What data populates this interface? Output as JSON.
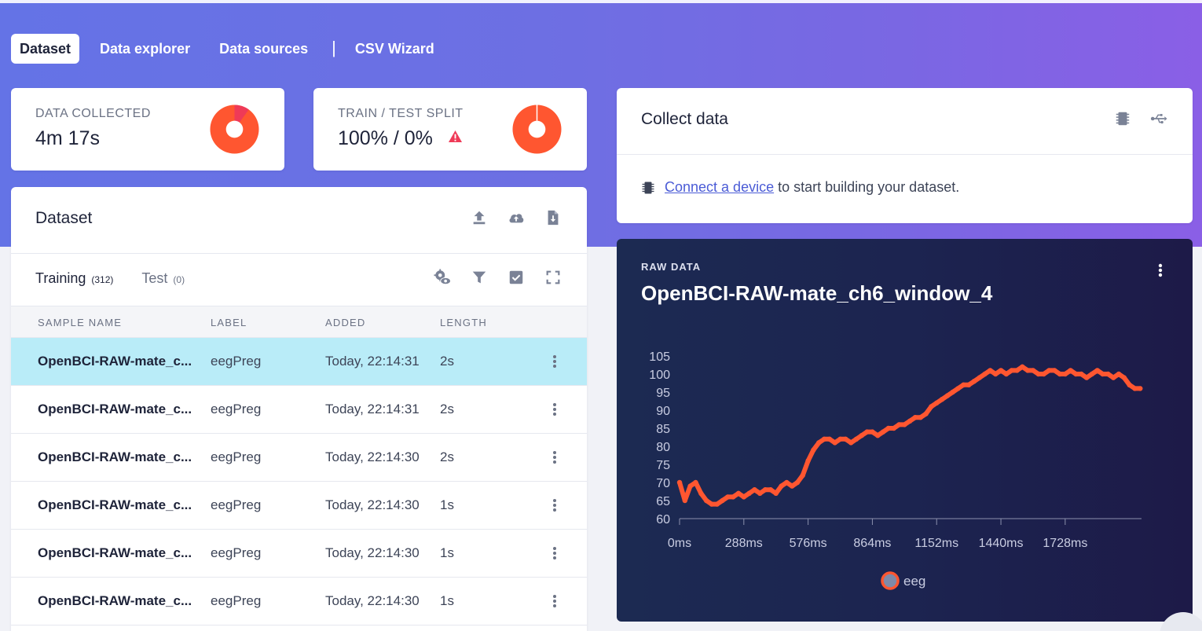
{
  "tabs": [
    {
      "label": "Dataset",
      "active": true
    },
    {
      "label": "Data explorer",
      "active": false
    },
    {
      "label": "Data sources",
      "active": false
    },
    {
      "label": "CSV Wizard",
      "active": false
    }
  ],
  "tab_separator": "|",
  "stats": {
    "collected": {
      "label": "DATA COLLECTED",
      "value": "4m 17s",
      "fraction_highlight": 0.1
    },
    "split": {
      "label": "TRAIN / TEST SPLIT",
      "value": "100% / 0%",
      "warning_icon": "warning-triangle-icon",
      "fraction_train": 1.0
    }
  },
  "dataset": {
    "title": "Dataset",
    "actions": [
      "upload-icon",
      "cloud-upload-icon",
      "download-file-icon"
    ],
    "subtabs": [
      {
        "label": "Training",
        "count": "(312)",
        "active": true
      },
      {
        "label": "Test",
        "count": "(0)",
        "active": false
      }
    ],
    "list_actions": [
      "settings-eye-icon",
      "filter-icon",
      "check-square-icon",
      "expand-icon"
    ],
    "columns": [
      "SAMPLE NAME",
      "LABEL",
      "ADDED",
      "LENGTH"
    ],
    "rows": [
      {
        "name": "OpenBCI-RAW-mate_c...",
        "label": "eegPreg",
        "added": "Today, 22:14:31",
        "length": "2s",
        "selected": true
      },
      {
        "name": "OpenBCI-RAW-mate_c...",
        "label": "eegPreg",
        "added": "Today, 22:14:31",
        "length": "2s",
        "selected": false
      },
      {
        "name": "OpenBCI-RAW-mate_c...",
        "label": "eegPreg",
        "added": "Today, 22:14:30",
        "length": "2s",
        "selected": false
      },
      {
        "name": "OpenBCI-RAW-mate_c...",
        "label": "eegPreg",
        "added": "Today, 22:14:30",
        "length": "1s",
        "selected": false
      },
      {
        "name": "OpenBCI-RAW-mate_c...",
        "label": "eegPreg",
        "added": "Today, 22:14:30",
        "length": "1s",
        "selected": false
      },
      {
        "name": "OpenBCI-RAW-mate_c...",
        "label": "eegPreg",
        "added": "Today, 22:14:30",
        "length": "1s",
        "selected": false
      }
    ]
  },
  "collect": {
    "title": "Collect data",
    "actions": [
      "chip-icon",
      "usb-icon"
    ],
    "link_text": "Connect a device",
    "body_text": "to start building your dataset."
  },
  "raw": {
    "label": "RAW DATA",
    "title": "OpenBCI-RAW-mate_ch6_window_4"
  },
  "colors": {
    "accent": "#ff5630",
    "pie_secondary": "#ef3a57",
    "link": "#4a5bd6",
    "selected_row": "#b9ecf8",
    "warning": "#ef3a57"
  },
  "chart_data": {
    "type": "line",
    "title": "",
    "xlabel": "",
    "ylabel": "",
    "x_ticks": [
      "0ms",
      "288ms",
      "576ms",
      "864ms",
      "1152ms",
      "1440ms",
      "1728ms"
    ],
    "y_ticks": [
      60,
      65,
      70,
      75,
      80,
      85,
      90,
      95,
      100,
      105
    ],
    "xlim": [
      0,
      2070
    ],
    "ylim": [
      60,
      105
    ],
    "legend": "bottom-center",
    "series": [
      {
        "name": "eeg",
        "color": "#ff5630",
        "x": [
          0,
          24,
          48,
          72,
          96,
          120,
          144,
          168,
          192,
          216,
          240,
          264,
          288,
          312,
          336,
          360,
          384,
          408,
          432,
          456,
          480,
          504,
          528,
          552,
          576,
          600,
          624,
          648,
          672,
          696,
          720,
          744,
          768,
          792,
          816,
          840,
          864,
          888,
          912,
          936,
          960,
          984,
          1008,
          1032,
          1056,
          1080,
          1104,
          1128,
          1152,
          1176,
          1200,
          1224,
          1248,
          1272,
          1296,
          1320,
          1344,
          1368,
          1392,
          1416,
          1440,
          1464,
          1488,
          1512,
          1536,
          1560,
          1584,
          1608,
          1632,
          1656,
          1680,
          1704,
          1728,
          1752,
          1776,
          1800,
          1824,
          1848,
          1872,
          1896,
          1920,
          1944,
          1968,
          1992,
          2016,
          2040,
          2064
        ],
        "values": [
          70,
          65,
          69,
          70,
          67,
          65,
          64,
          64,
          65,
          66,
          66,
          67,
          66,
          67,
          68,
          67,
          68,
          68,
          67,
          69,
          70,
          69,
          70,
          72,
          76,
          79,
          81,
          82,
          82,
          81,
          82,
          82,
          81,
          82,
          83,
          84,
          84,
          83,
          84,
          85,
          85,
          86,
          86,
          87,
          88,
          88,
          89,
          91,
          92,
          93,
          94,
          95,
          96,
          97,
          97,
          98,
          99,
          100,
          101,
          100,
          101,
          100,
          101,
          101,
          102,
          101,
          101,
          100,
          100,
          101,
          101,
          100,
          100,
          101,
          100,
          100,
          99,
          100,
          101,
          100,
          100,
          99,
          100,
          99,
          97,
          96,
          96
        ]
      }
    ]
  }
}
